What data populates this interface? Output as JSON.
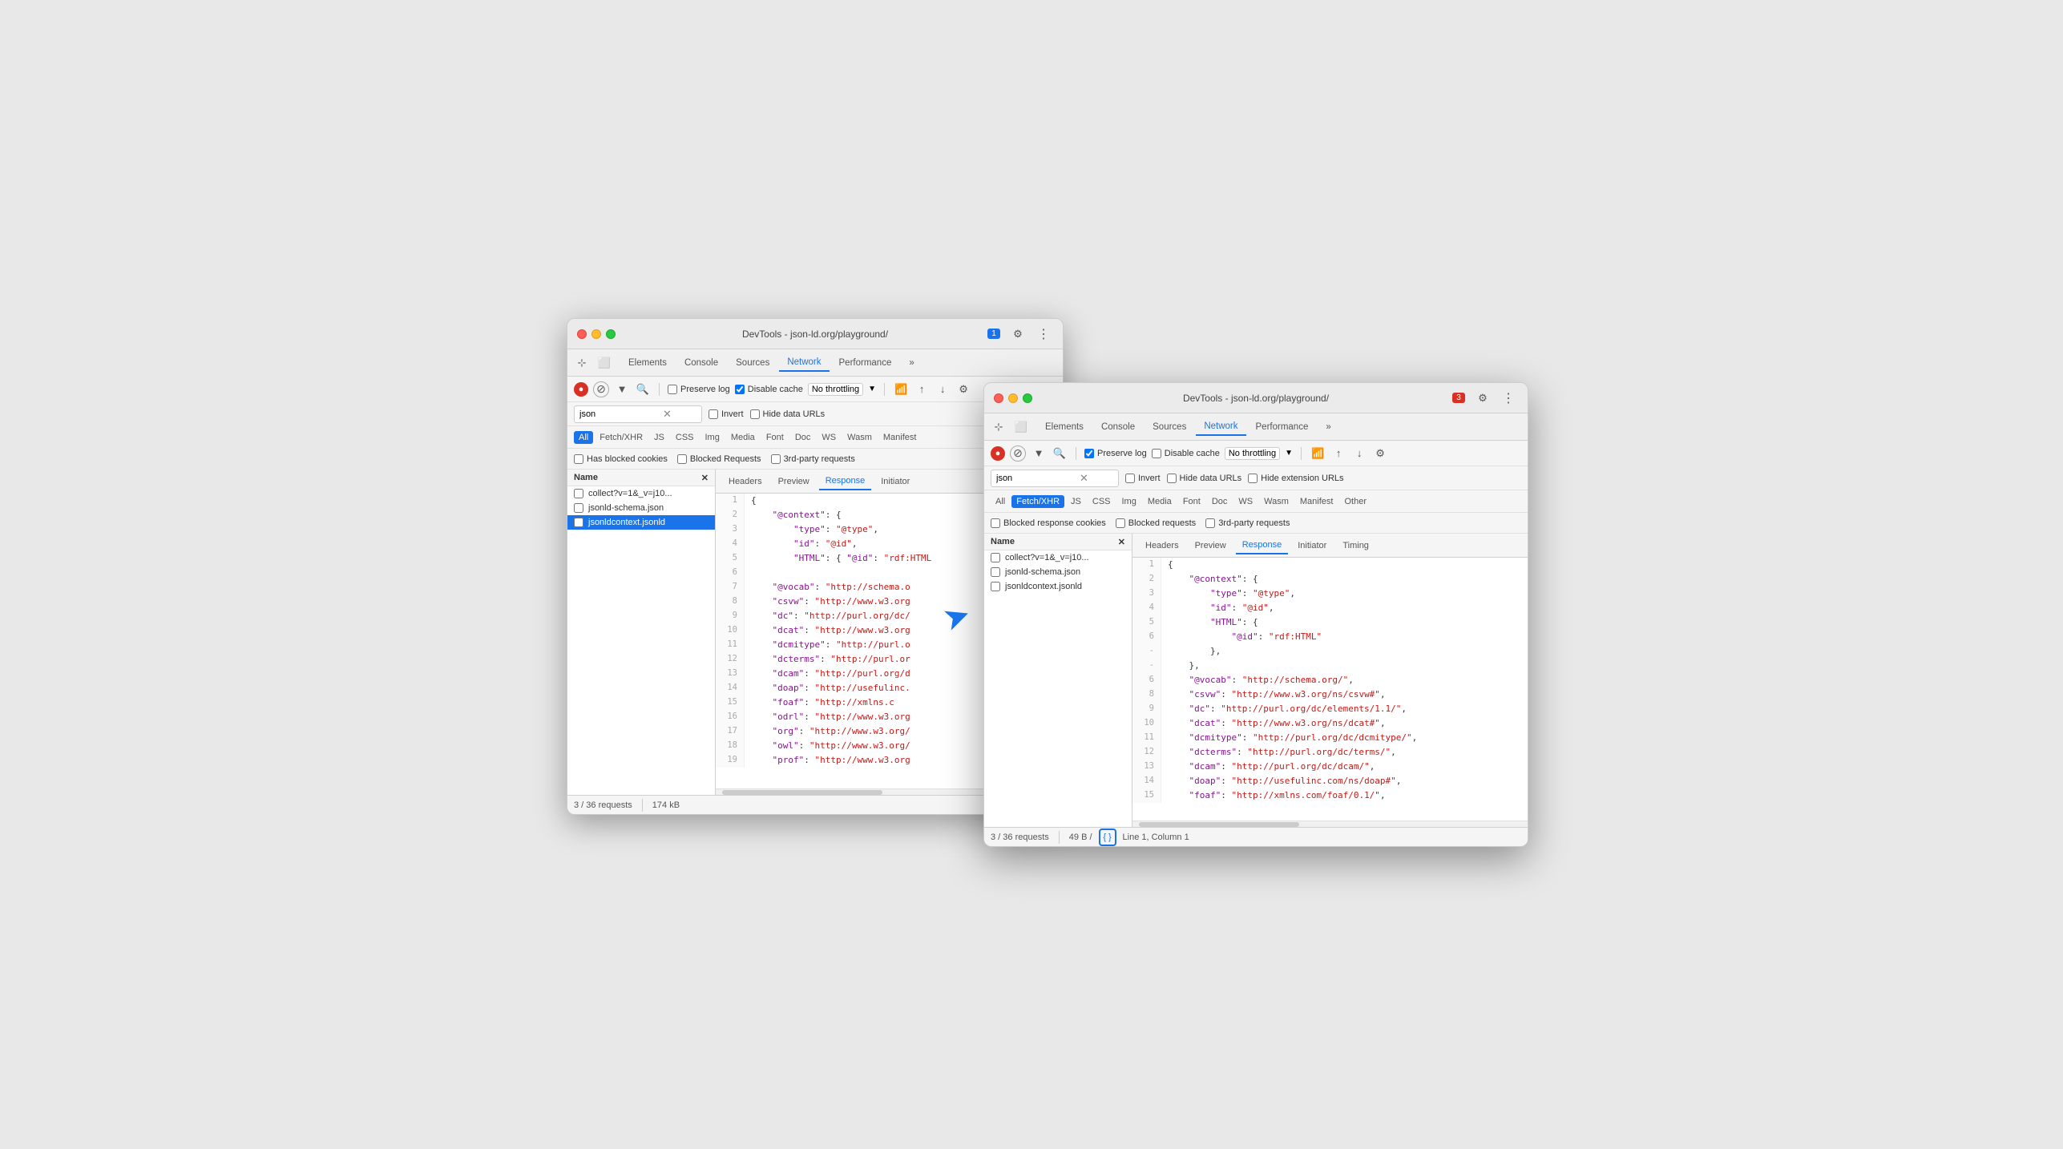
{
  "back_window": {
    "title": "DevTools - json-ld.org/playground/",
    "tabs": [
      "Elements",
      "Console",
      "Sources",
      "Network",
      "Performance"
    ],
    "active_tab": "Network",
    "toolbar": {
      "preserve_log": true,
      "disable_cache": true,
      "throttle": "No throttling"
    },
    "search_value": "json",
    "filter_tabs": [
      "All",
      "Fetch/XHR",
      "JS",
      "CSS",
      "Img",
      "Media",
      "Font",
      "Doc",
      "WS",
      "Wasm",
      "Manifest"
    ],
    "active_filter": "All",
    "blocked_row": [
      "Has blocked cookies",
      "Blocked Requests",
      "3rd-party requests"
    ],
    "files": [
      {
        "name": "collect?v=1&_v=j10...",
        "checked": false
      },
      {
        "name": "jsonld-schema.json",
        "checked": false
      },
      {
        "name": "jsonldcontext.jsonld",
        "checked": false,
        "selected": true
      }
    ],
    "response_tabs": [
      "Headers",
      "Preview",
      "Response",
      "Initiator"
    ],
    "active_response_tab": "Response",
    "code_lines": [
      {
        "num": "1",
        "content": "{"
      },
      {
        "num": "2",
        "content": "    \"@context\": {"
      },
      {
        "num": "3",
        "content": "        \"type\": \"@type\","
      },
      {
        "num": "4",
        "content": "        \"id\": \"@id\","
      },
      {
        "num": "5",
        "content": "        \"HTML\": { \"@id\": \"rdf:HTML"
      },
      {
        "num": "6",
        "content": ""
      },
      {
        "num": "7",
        "content": "    \"@vocab\": \"http://schema.o"
      },
      {
        "num": "8",
        "content": "    \"csvw\": \"http://www.w3.org"
      },
      {
        "num": "9",
        "content": "    \"dc\": \"http://purl.org/dc/"
      },
      {
        "num": "10",
        "content": "    \"dcat\": \"http://www.w3.org"
      },
      {
        "num": "11",
        "content": "    \"dcmitype\": \"http://purl.o"
      },
      {
        "num": "12",
        "content": "    \"dcterms\": \"http://purl.or"
      },
      {
        "num": "13",
        "content": "    \"dcam\": \"http://purl.org/d"
      },
      {
        "num": "14",
        "content": "    \"doap\": \"http://usefulinc."
      },
      {
        "num": "15",
        "content": "    \"foaf\": \"http://xmlns.c"
      },
      {
        "num": "16",
        "content": "    \"odrl\": \"http://www.w3.org"
      },
      {
        "num": "17",
        "content": "    \"org\": \"http://www.w3.org/"
      },
      {
        "num": "18",
        "content": "    \"owl\": \"http://www.w3.org/"
      },
      {
        "num": "19",
        "content": "    \"prof\": \"http://www.w3.org"
      }
    ],
    "status": "3 / 36 requests",
    "size": "174 kB"
  },
  "front_window": {
    "title": "DevTools - json-ld.org/playground/",
    "tabs": [
      "Elements",
      "Console",
      "Sources",
      "Network",
      "Performance"
    ],
    "active_tab": "Network",
    "errors_badge": "3",
    "toolbar": {
      "preserve_log": true,
      "disable_cache": false,
      "throttle": "No throttling"
    },
    "search_value": "json",
    "filter_tabs": [
      "All",
      "Fetch/XHR",
      "JS",
      "CSS",
      "Img",
      "Media",
      "Font",
      "Doc",
      "WS",
      "Wasm",
      "Manifest",
      "Other"
    ],
    "active_filter": "Fetch/XHR",
    "blocked_row": [
      "Blocked response cookies",
      "Blocked requests",
      "3rd-party requests"
    ],
    "files": [
      {
        "name": "collect?v=1&_v=j10...",
        "checked": false
      },
      {
        "name": "jsonld-schema.json",
        "checked": false
      },
      {
        "name": "jsonldcontext.jsonld",
        "checked": false
      }
    ],
    "response_tabs": [
      "Headers",
      "Preview",
      "Response",
      "Initiator",
      "Timing"
    ],
    "active_response_tab": "Response",
    "code_lines": [
      {
        "num": "1",
        "content": "{",
        "plain": true
      },
      {
        "num": "2",
        "content": "    \"@context\": {",
        "key": "@context"
      },
      {
        "num": "3",
        "content": "        \"type\": \"@type\",",
        "key": "type",
        "value": "@type"
      },
      {
        "num": "4",
        "content": "        \"id\": \"@id\",",
        "key": "id",
        "value": "@id"
      },
      {
        "num": "5",
        "content": "        \"HTML\": {",
        "key": "HTML"
      },
      {
        "num": "6",
        "content": "            \"@id\": \"rdf:HTML\"",
        "key": "@id",
        "value": "rdf:HTML"
      },
      {
        "num": "-a",
        "content": "        },"
      },
      {
        "num": "-b",
        "content": "    },"
      },
      {
        "num": "6",
        "content": "    \"@vocab\": \"http://schema.org/\",",
        "key": "@vocab",
        "value": "http://schema.org/"
      },
      {
        "num": "8",
        "content": "    \"csvw\": \"http://www.w3.org/ns/csvw#\",",
        "key": "csvw",
        "value": "http://www.w3.org/ns/csvw#"
      },
      {
        "num": "9",
        "content": "    \"dc\": \"http://purl.org/dc/elements/1.1/\",",
        "key": "dc",
        "value": "http://purl.org/dc/elements/1.1/"
      },
      {
        "num": "10",
        "content": "    \"dcat\": \"http://www.w3.org/ns/dcat#\",",
        "key": "dcat",
        "value": "http://www.w3.org/ns/dcat#"
      },
      {
        "num": "11",
        "content": "    \"dcmitype\": \"http://purl.org/dc/dcmitype/\",",
        "key": "dcmitype",
        "value": "http://purl.org/dc/dcmitype/"
      },
      {
        "num": "12",
        "content": "    \"dcterms\": \"http://purl.org/dc/terms/\",",
        "key": "dcterms",
        "value": "http://purl.org/dc/terms/"
      },
      {
        "num": "13",
        "content": "    \"dcam\": \"http://purl.org/dc/dcam/\",",
        "key": "dcam",
        "value": "http://purl.org/dc/dcam/"
      },
      {
        "num": "14",
        "content": "    \"doap\": \"http://usefulinc.com/ns/doap#\",",
        "key": "doap",
        "value": "http://usefulinc.com/ns/doap#"
      },
      {
        "num": "15",
        "content": "    \"foaf\": \"http://xmlns.com/foaf/0.1/\",",
        "key": "foaf",
        "value": "http://xmlns.com/foaf/0.1/"
      }
    ],
    "status": "3 / 36 requests",
    "size": "49 B /",
    "position": "Line 1, Column 1"
  },
  "arrow": {
    "pointing_to": "front_window"
  }
}
